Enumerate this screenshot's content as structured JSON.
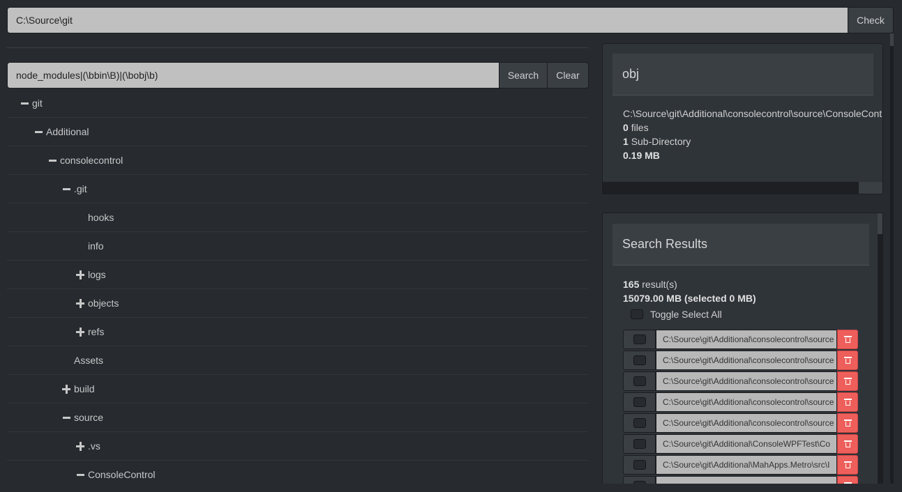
{
  "top_bar": {
    "path_value": "C:\\Source\\git",
    "check_label": "Check"
  },
  "filter": {
    "value": "node_modules|(\\bbin\\B)|(\\bobj\\b)",
    "search_label": "Search",
    "clear_label": "Clear"
  },
  "tree": [
    {
      "label": "git",
      "toggle": "minus",
      "depth": 0
    },
    {
      "label": "Additional",
      "toggle": "minus",
      "depth": 1
    },
    {
      "label": "consolecontrol",
      "toggle": "minus",
      "depth": 2
    },
    {
      "label": ".git",
      "toggle": "minus",
      "depth": 3
    },
    {
      "label": "hooks",
      "toggle": "none",
      "depth": 4
    },
    {
      "label": "info",
      "toggle": "none",
      "depth": 4
    },
    {
      "label": "logs",
      "toggle": "plus",
      "depth": 4
    },
    {
      "label": "objects",
      "toggle": "plus",
      "depth": 4
    },
    {
      "label": "refs",
      "toggle": "plus",
      "depth": 4
    },
    {
      "label": "Assets",
      "toggle": "none",
      "depth": 3
    },
    {
      "label": "build",
      "toggle": "plus",
      "depth": 3
    },
    {
      "label": "source",
      "toggle": "minus",
      "depth": 3
    },
    {
      "label": ".vs",
      "toggle": "plus",
      "depth": 4
    },
    {
      "label": "ConsoleControl",
      "toggle": "minus",
      "depth": 4
    }
  ],
  "info": {
    "title": "obj",
    "path": "C:\\Source\\git\\Additional\\consolecontrol\\source\\ConsoleControl",
    "files_count": "0",
    "files_label": "files",
    "subdir_count": "1",
    "subdir_label": "Sub-Directory",
    "size": "0.19 MB"
  },
  "results": {
    "title": "Search Results",
    "count": "165",
    "count_label": "result(s)",
    "size_text": "15079.00 MB (selected 0 MB)",
    "toggle_all_label": "Toggle Select All",
    "rows": [
      "C:\\Source\\git\\Additional\\consolecontrol\\source",
      "C:\\Source\\git\\Additional\\consolecontrol\\source",
      "C:\\Source\\git\\Additional\\consolecontrol\\source",
      "C:\\Source\\git\\Additional\\consolecontrol\\source",
      "C:\\Source\\git\\Additional\\consolecontrol\\source",
      "C:\\Source\\git\\Additional\\ConsoleWPFTest\\Co",
      "C:\\Source\\git\\Additional\\MahApps.Metro\\src\\I",
      ""
    ]
  },
  "colors": {
    "background": "#272b30",
    "panel": "#2f3439",
    "header": "#3a3f44",
    "delete": "#ee5f5b",
    "input": "#c0c0c0"
  }
}
